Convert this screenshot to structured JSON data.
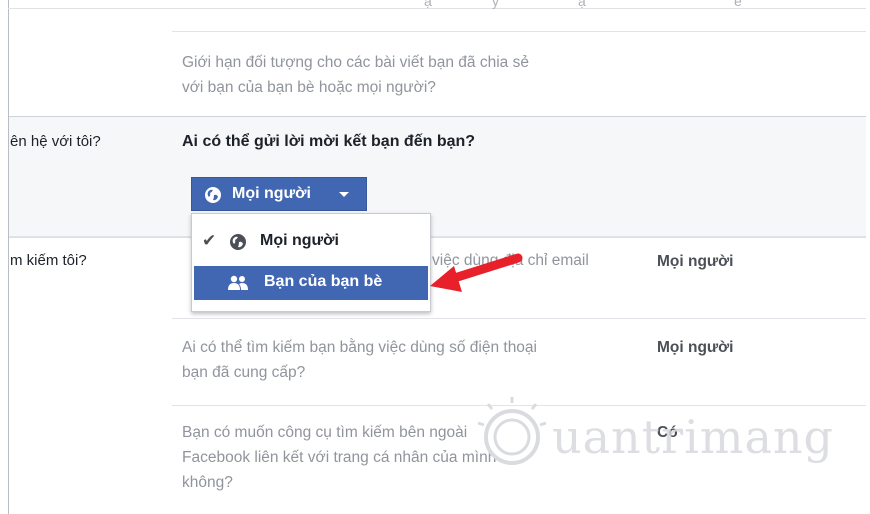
{
  "top_fragments": [
    "ạ",
    "ỳ",
    "ạ",
    "ẻ"
  ],
  "rows": {
    "limit_past": {
      "question_line1": "Giới hạn đối tượng cho các bài viết bạn đã chia sẻ",
      "question_line2": "với bạn của bạn bè hoặc mọi người?"
    },
    "contact": {
      "left_label": "ên hệ với tôi?",
      "question": "Ai có thể gửi lời mời kết bạn đến bạn?",
      "button_label": "Mọi người",
      "menu": {
        "item1": "Mọi người",
        "item2": "Bạn của bạn bè"
      }
    },
    "search_email": {
      "left_label": "m kiếm tôi?",
      "question_fragment": "việc dùng địa chỉ email",
      "value": "Mọi người"
    },
    "search_phone": {
      "question_line1": "Ai có thể tìm kiếm bạn bằng việc dùng số điện thoại",
      "question_line2": "bạn đã cung cấp?",
      "value": "Mọi người"
    },
    "search_engine": {
      "question_line1": "Bạn có muốn công cụ tìm kiếm bên ngoài",
      "question_line2": "Facebook liên kết với trang cá nhân của mình",
      "question_line3": "không?",
      "value": "Có"
    }
  },
  "watermark": {
    "text": "uantrimang"
  },
  "colors": {
    "fb_blue": "#4267b2",
    "arrow_red": "#e8202a"
  }
}
